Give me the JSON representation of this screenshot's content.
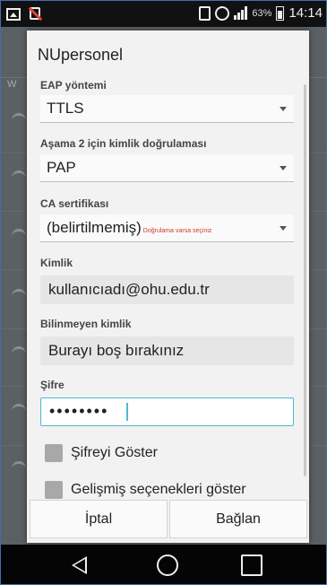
{
  "status": {
    "battery_pct": "63%",
    "time": "14:14"
  },
  "dialog": {
    "title": "NUpersonel",
    "eap_method": {
      "label": "EAP yöntemi",
      "value": "TTLS"
    },
    "phase2": {
      "label": "Aşama 2 için kimlik doğrulaması",
      "value": "PAP"
    },
    "ca_cert": {
      "label": "CA sertifikası",
      "value": "(belirtilmemiş)",
      "hint": "Doğrulama varsa seçiniz"
    },
    "identity": {
      "label": "Kimlik",
      "value": "kullanıcıadı@ohu.edu.tr"
    },
    "anonymous": {
      "label": "Bilinmeyen kimlik",
      "value": "Burayı boş bırakınız"
    },
    "password": {
      "label": "Şifre",
      "value": "••••••••"
    },
    "show_password": "Şifreyi Göster",
    "advanced": "Gelişmiş seçenekleri göster",
    "cancel": "İptal",
    "connect": "Bağlan"
  },
  "colors": {
    "accent": "#4fb8d1",
    "hint_red": "#d4372a"
  },
  "icons": [
    "image-icon",
    "no-sim-icon",
    "phone-icon",
    "alarm-icon",
    "signal-icon",
    "battery-icon",
    "wifi-icon",
    "caret-down-icon",
    "checkbox-icon",
    "back-icon",
    "home-icon",
    "recent-apps-icon"
  ]
}
